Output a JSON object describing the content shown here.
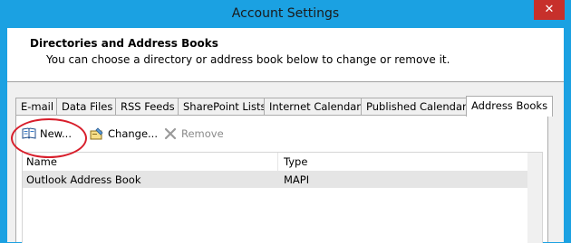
{
  "window": {
    "title": "Account Settings",
    "close_glyph": "✕"
  },
  "header": {
    "title": "Directories and Address Books",
    "subtitle": "You can choose a directory or address book below to change or remove it."
  },
  "tabs": [
    {
      "label": "E-mail",
      "active": false
    },
    {
      "label": "Data Files",
      "active": false
    },
    {
      "label": "RSS Feeds",
      "active": false
    },
    {
      "label": "SharePoint Lists",
      "active": false
    },
    {
      "label": "Internet Calendars",
      "active": false
    },
    {
      "label": "Published Calendars",
      "active": false
    },
    {
      "label": "Address Books",
      "active": true
    }
  ],
  "toolbar": {
    "new_label": "New...",
    "change_label": "Change...",
    "remove_label": "Remove"
  },
  "list": {
    "columns": [
      "Name",
      "Type"
    ],
    "rows": [
      {
        "name": "Outlook Address Book",
        "type": "MAPI",
        "selected": true
      }
    ]
  },
  "colors": {
    "frame": "#1ba1e2",
    "close": "#c7302b",
    "highlight": "#d81e2b"
  }
}
